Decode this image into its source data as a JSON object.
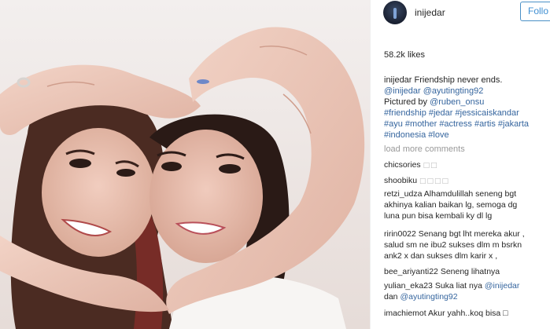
{
  "photo": {
    "alt_subject": "two-women-heart-hands-selfie"
  },
  "header": {
    "username": "inijedar",
    "follow_label": "Follo"
  },
  "likes": "58.2k likes",
  "caption": {
    "user": "inijedar",
    "text_line1": "Friendship never ends.",
    "mention1": "@inijedar",
    "mention2": "@ayutingting92",
    "pictured_prefix": "Pictured by",
    "mention3": "@ruben_onsu",
    "tags_line1": "#friendship #jedar #jessicaiskandar",
    "tags_line2": "#ayu #mother #actress #artis #jakarta",
    "tags_line3": "#indonesia #love"
  },
  "load_more": "load more comments",
  "comments": [
    {
      "user": "chicsories",
      "lines": [
        "□□"
      ]
    },
    {
      "user": "shoobiku",
      "lines": [
        "□□□□"
      ]
    },
    {
      "user": "retzi_udza",
      "lines": [
        "Alhamdulillah seneng bgt",
        "akhinya kalian baikan lg, semoga dg",
        "luna pun bisa kembali ky dl lg"
      ]
    },
    {
      "user": "ririn0022",
      "lines": [
        "Senang bgt lht mereka akur ,",
        "salud sm ne ibu2 sukses dlm m bsrkn",
        "ank2 x dan sukses dlm karir x ,"
      ]
    },
    {
      "user": "bee_ariyanti22",
      "lines": [
        "Seneng lihatnya"
      ]
    },
    {
      "user": "yulian_eka23",
      "lines": [
        "Suka liat nya",
        "dan"
      ],
      "mentions": [
        "@inijedar",
        "@ayutingting92"
      ]
    },
    {
      "user": "imachiemot",
      "lines": [
        "Akur yahh..koq bisa □"
      ]
    }
  ],
  "colors": {
    "link": "#35659e",
    "follow_border": "#4a90c6",
    "muted": "#999999"
  }
}
